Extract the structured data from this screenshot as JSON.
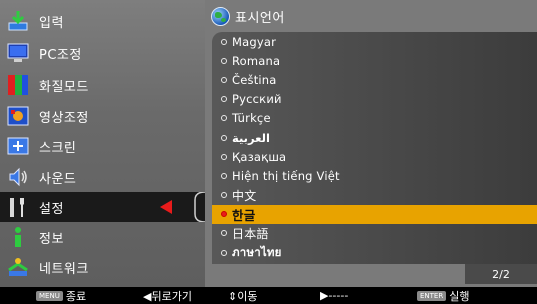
{
  "menu": {
    "items": [
      {
        "label": "입력",
        "icon": "input-icon"
      },
      {
        "label": "PC조정",
        "icon": "pc-monitor-icon"
      },
      {
        "label": "화질모드",
        "icon": "picture-mode-icon"
      },
      {
        "label": "영상조정",
        "icon": "image-adjust-icon"
      },
      {
        "label": "스크린",
        "icon": "screen-icon"
      },
      {
        "label": "사운드",
        "icon": "sound-icon"
      },
      {
        "label": "설정",
        "icon": "settings-tools-icon"
      },
      {
        "label": "정보",
        "icon": "information-icon"
      },
      {
        "label": "네트워크",
        "icon": "network-icon"
      }
    ],
    "active_index": 6
  },
  "panel": {
    "title": "표시언어",
    "languages": [
      "Magyar",
      "Romana",
      "Čeština",
      "Pусский",
      "Türkçe",
      "العربية",
      "Қазақша",
      "Hiện thị tiếng Việt",
      "中文",
      "한글",
      "日本語",
      "ภาษาไทย"
    ],
    "selected_index": 9,
    "page": "2/2"
  },
  "bottom_bar": {
    "menu_badge": "MENU",
    "menu_label": "종료",
    "back_label": "◀뒤로가기",
    "move_label": "⇕이동",
    "next_label": "▶-----",
    "enter_badge": "ENTER",
    "enter_label": "실행"
  },
  "colors": {
    "accent_selected": "#e8a300",
    "active_arrow": "#e81b1b"
  }
}
